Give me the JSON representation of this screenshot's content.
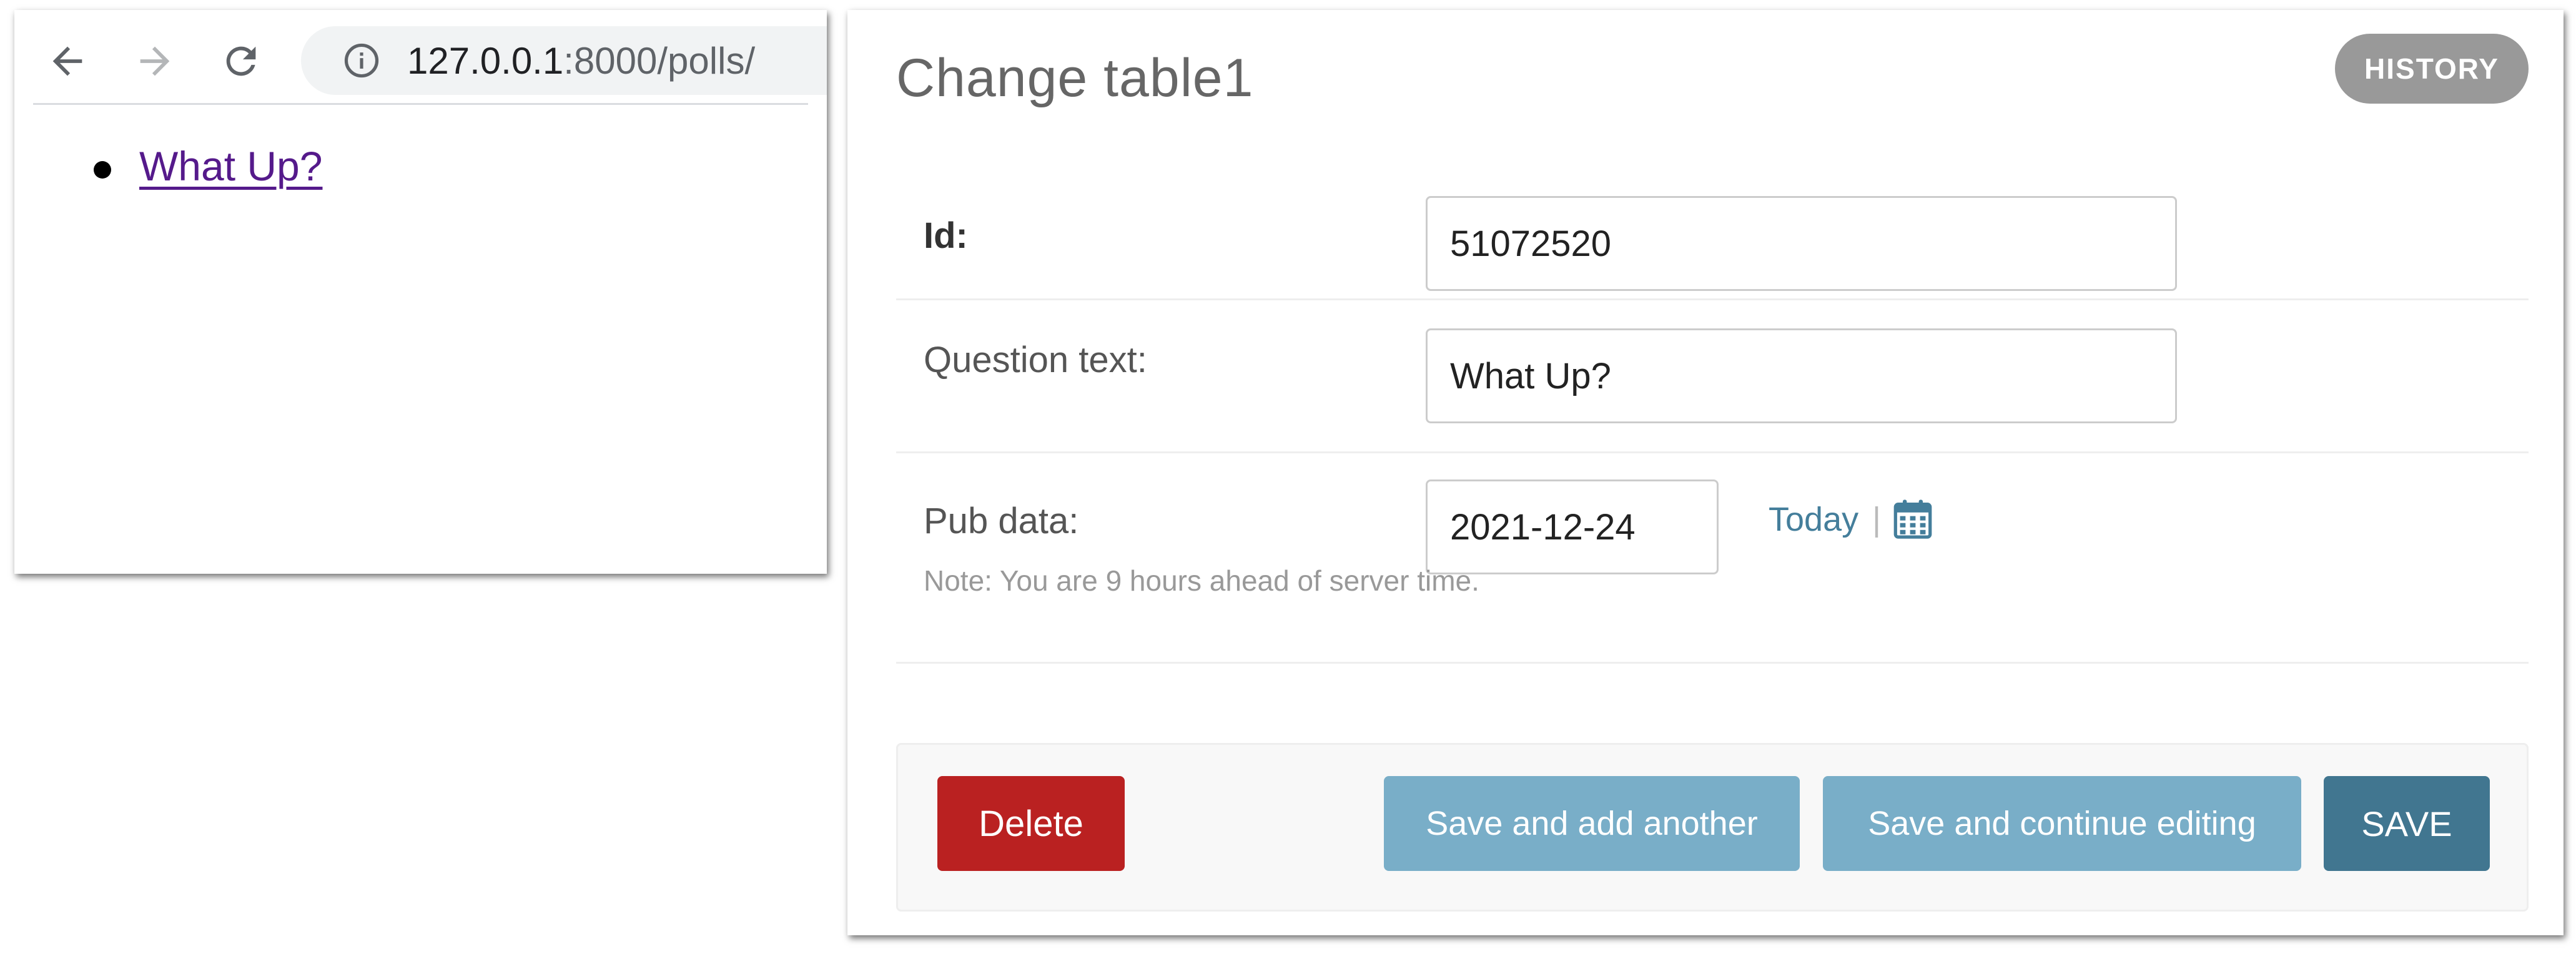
{
  "browser": {
    "url_host": "127.0.0.1",
    "url_rest": ":8000/polls/",
    "icons": {
      "back": "arrow-left-icon",
      "forward": "arrow-right-icon",
      "reload": "reload-icon",
      "site_info": "info-circle-icon"
    },
    "page": {
      "links": [
        {
          "text": "What Up?"
        }
      ]
    }
  },
  "admin": {
    "title": "Change table1",
    "history_label": "HISTORY",
    "fields": {
      "id": {
        "label": "Id:",
        "value": "51072520"
      },
      "question_text": {
        "label": "Question text:",
        "value": "What Up?"
      },
      "pub_data": {
        "label": "Pub data:",
        "value": "2021-12-24",
        "today_label": "Today",
        "separator": "|",
        "icon": "calendar-icon",
        "note": "Note: You are 9 hours ahead of server time."
      }
    },
    "actions": {
      "delete_label": "Delete",
      "save_add_another_label": "Save and add another",
      "save_continue_label": "Save and continue editing",
      "save_label": "SAVE"
    }
  },
  "colors": {
    "delete": "#ba2121",
    "secondary_button": "#79aec8",
    "primary_button": "#417690",
    "link": "#447e9b",
    "visited_link": "#551a8b",
    "history_button": "#999999"
  }
}
